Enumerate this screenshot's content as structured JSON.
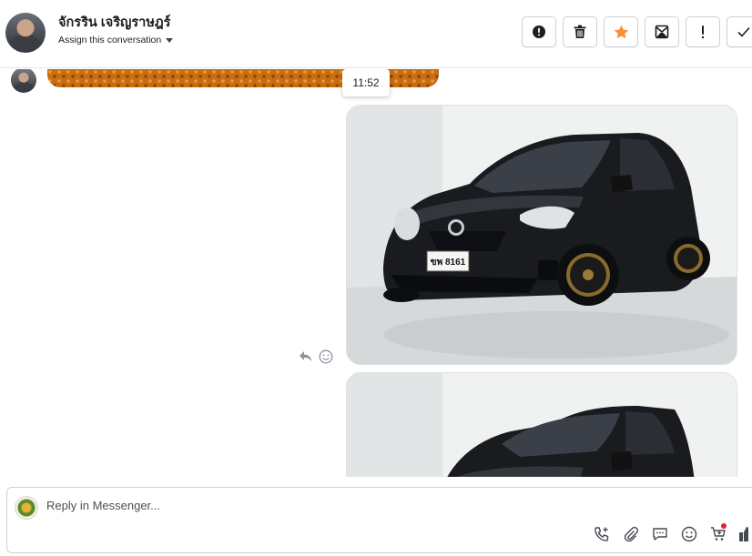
{
  "header": {
    "contact_name": "จักรริน เจริญราษฎร์",
    "assign_label": "Assign this conversation"
  },
  "actions": [
    {
      "icon": "alert-circle-icon"
    },
    {
      "icon": "trash-icon"
    },
    {
      "icon": "star-icon",
      "color": "#f7923a"
    },
    {
      "icon": "mark-unread-icon"
    },
    {
      "icon": "exclamation-icon"
    },
    {
      "icon": "check-icon"
    }
  ],
  "conversation": {
    "timestamp": "11:52",
    "plate_text": "ขพ 8161"
  },
  "composer": {
    "placeholder": "Reply in Messenger..."
  }
}
